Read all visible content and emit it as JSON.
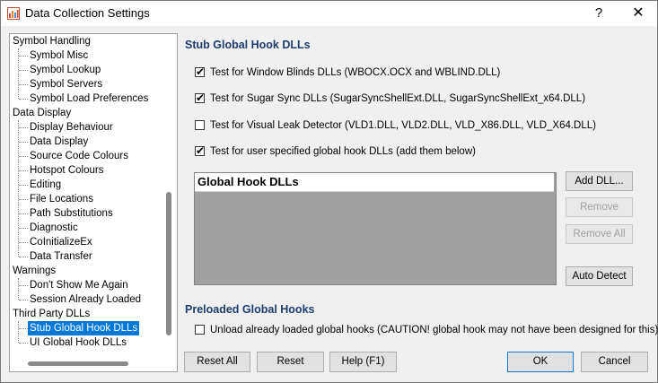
{
  "window": {
    "title": "Data Collection Settings",
    "help_glyph": "?",
    "close_glyph": "✕"
  },
  "tree": {
    "items": [
      {
        "label": "Symbol Handling",
        "level": 0
      },
      {
        "label": "Symbol Misc",
        "level": 1
      },
      {
        "label": "Symbol Lookup",
        "level": 1
      },
      {
        "label": "Symbol Servers",
        "level": 1
      },
      {
        "label": "Symbol Load Preferences",
        "level": 1
      },
      {
        "label": "Data Display",
        "level": 0
      },
      {
        "label": "Display Behaviour",
        "level": 1
      },
      {
        "label": "Data Display",
        "level": 1
      },
      {
        "label": "Source Code Colours",
        "level": 1
      },
      {
        "label": "Hotspot Colours",
        "level": 1
      },
      {
        "label": "Editing",
        "level": 1
      },
      {
        "label": "File Locations",
        "level": 1
      },
      {
        "label": "Path Substitutions",
        "level": 1
      },
      {
        "label": "Diagnostic",
        "level": 1
      },
      {
        "label": "CoInitializeEx",
        "level": 1
      },
      {
        "label": "Data Transfer",
        "level": 1
      },
      {
        "label": "Warnings",
        "level": 0
      },
      {
        "label": "Don't Show Me Again",
        "level": 1
      },
      {
        "label": "Session Already Loaded",
        "level": 1
      },
      {
        "label": "Third Party DLLs",
        "level": 0
      },
      {
        "label": "Stub Global Hook DLLs",
        "level": 1,
        "selected": true
      },
      {
        "label": "UI Global Hook DLLs",
        "level": 1
      }
    ]
  },
  "stub_section": {
    "title": "Stub Global Hook DLLs",
    "checkboxes": [
      {
        "label": "Test for Window Blinds DLLs (WBOCX.OCX and WBLIND.DLL)",
        "checked": true
      },
      {
        "label": "Test for Sugar Sync DLLs (SugarSyncShellExt.DLL, SugarSyncShellExt_x64.DLL)",
        "checked": true
      },
      {
        "label": "Test for Visual Leak Detector (VLD1.DLL, VLD2.DLL, VLD_X86.DLL, VLD_X64.DLL)",
        "checked": false
      },
      {
        "label": "Test for user specified global hook DLLs (add them below)",
        "checked": true
      }
    ],
    "list_header": "Global Hook DLLs",
    "buttons": {
      "add": "Add DLL...",
      "remove": "Remove",
      "remove_all": "Remove All",
      "auto_detect": "Auto Detect"
    }
  },
  "preloaded_section": {
    "title": "Preloaded Global Hooks",
    "checkbox": {
      "label": "Unload already loaded global hooks (CAUTION! global hook may not have been designed for this).",
      "checked": false
    }
  },
  "footer": {
    "reset_all": "Reset All",
    "reset": "Reset",
    "help": "Help (F1)",
    "ok": "OK",
    "cancel": "Cancel"
  },
  "colors": {
    "accent": "#0078d7",
    "section_title": "#1f3c6e"
  }
}
